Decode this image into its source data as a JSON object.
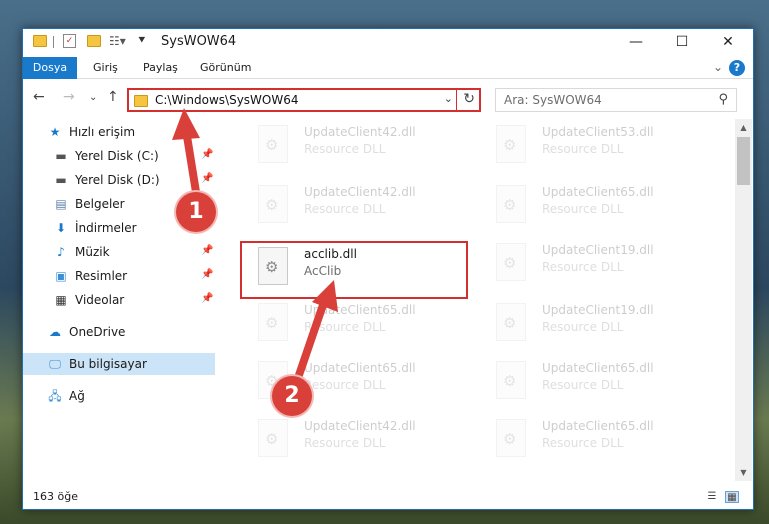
{
  "window": {
    "title": "SysWOW64"
  },
  "ribbon": {
    "tabs": [
      "Dosya",
      "Giriş",
      "Paylaş",
      "Görünüm"
    ]
  },
  "address": {
    "path": "C:\\Windows\\SysWOW64"
  },
  "search": {
    "placeholder": "Ara: SysWOW64"
  },
  "sidebar": {
    "items": [
      {
        "label": "Hızlı erişim"
      },
      {
        "label": "Yerel Disk (C:)"
      },
      {
        "label": "Yerel Disk (D:)"
      },
      {
        "label": "Belgeler"
      },
      {
        "label": "İndirmeler"
      },
      {
        "label": "Müzik"
      },
      {
        "label": "Resimler"
      },
      {
        "label": "Videolar"
      },
      {
        "label": "OneDrive"
      },
      {
        "label": "Bu bilgisayar"
      },
      {
        "label": "Ağ"
      }
    ]
  },
  "files": {
    "left": [
      {
        "name": "UpdateClient42.dll",
        "desc": "Resource DLL"
      },
      {
        "name": "UpdateClient42.dll",
        "desc": "Resource DLL"
      },
      {
        "name": "acclib.dll",
        "desc": "AcClib"
      },
      {
        "name": "UpdateClient65.dll",
        "desc": "Resource DLL"
      },
      {
        "name": "UpdateClient65.dll",
        "desc": "Resource DLL"
      },
      {
        "name": "UpdateClient42.dll",
        "desc": "Resource DLL"
      }
    ],
    "right": [
      {
        "name": "UpdateClient53.dll",
        "desc": "Resource DLL"
      },
      {
        "name": "UpdateClient65.dll",
        "desc": "Resource DLL"
      },
      {
        "name": "UpdateClient19.dll",
        "desc": "Resource DLL"
      },
      {
        "name": "UpdateClient19.dll",
        "desc": "Resource DLL"
      },
      {
        "name": "UpdateClient65.dll",
        "desc": "Resource DLL"
      },
      {
        "name": "UpdateClient65.dll",
        "desc": "Resource DLL"
      }
    ]
  },
  "status": {
    "count": "163 öğe"
  },
  "annotations": {
    "step1": "1",
    "step2": "2"
  },
  "colors": {
    "accent": "#1979ca",
    "highlight": "#d32f2f"
  }
}
